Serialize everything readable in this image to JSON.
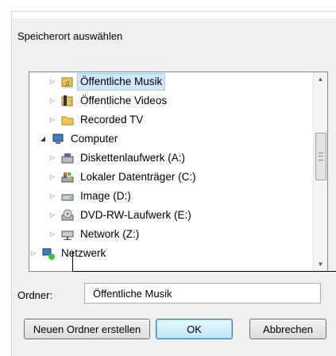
{
  "dialog": {
    "title": "Speicherort auswählen"
  },
  "tree": {
    "items": [
      {
        "label": "Öffentliche Musik",
        "icon": "music-folder-icon",
        "selected": true
      },
      {
        "label": "Öffentliche Videos",
        "icon": "video-folder-icon"
      },
      {
        "label": "Recorded TV",
        "icon": "folder-icon"
      },
      {
        "label": "Computer",
        "icon": "computer-icon",
        "expanded": true
      },
      {
        "label": "Diskettenlaufwerk (A:)",
        "icon": "floppy-drive-icon"
      },
      {
        "label": "Lokaler Datenträger (C:)",
        "icon": "local-disk-icon"
      },
      {
        "label": "Image (D:)",
        "icon": "drive-icon"
      },
      {
        "label": "DVD-RW-Laufwerk (E:)",
        "icon": "dvd-drive-icon"
      },
      {
        "label": "Network (Z:)",
        "icon": "network-drive-icon"
      },
      {
        "label": "Netzwerk",
        "icon": "network-icon"
      }
    ],
    "selection_color": "#cde8ff"
  },
  "folder": {
    "label": "Ordner:",
    "value": "Öffentliche Musik"
  },
  "buttons": {
    "new_folder": "Neuen Ordner erstellen",
    "ok": "OK",
    "cancel": "Abbrechen"
  }
}
